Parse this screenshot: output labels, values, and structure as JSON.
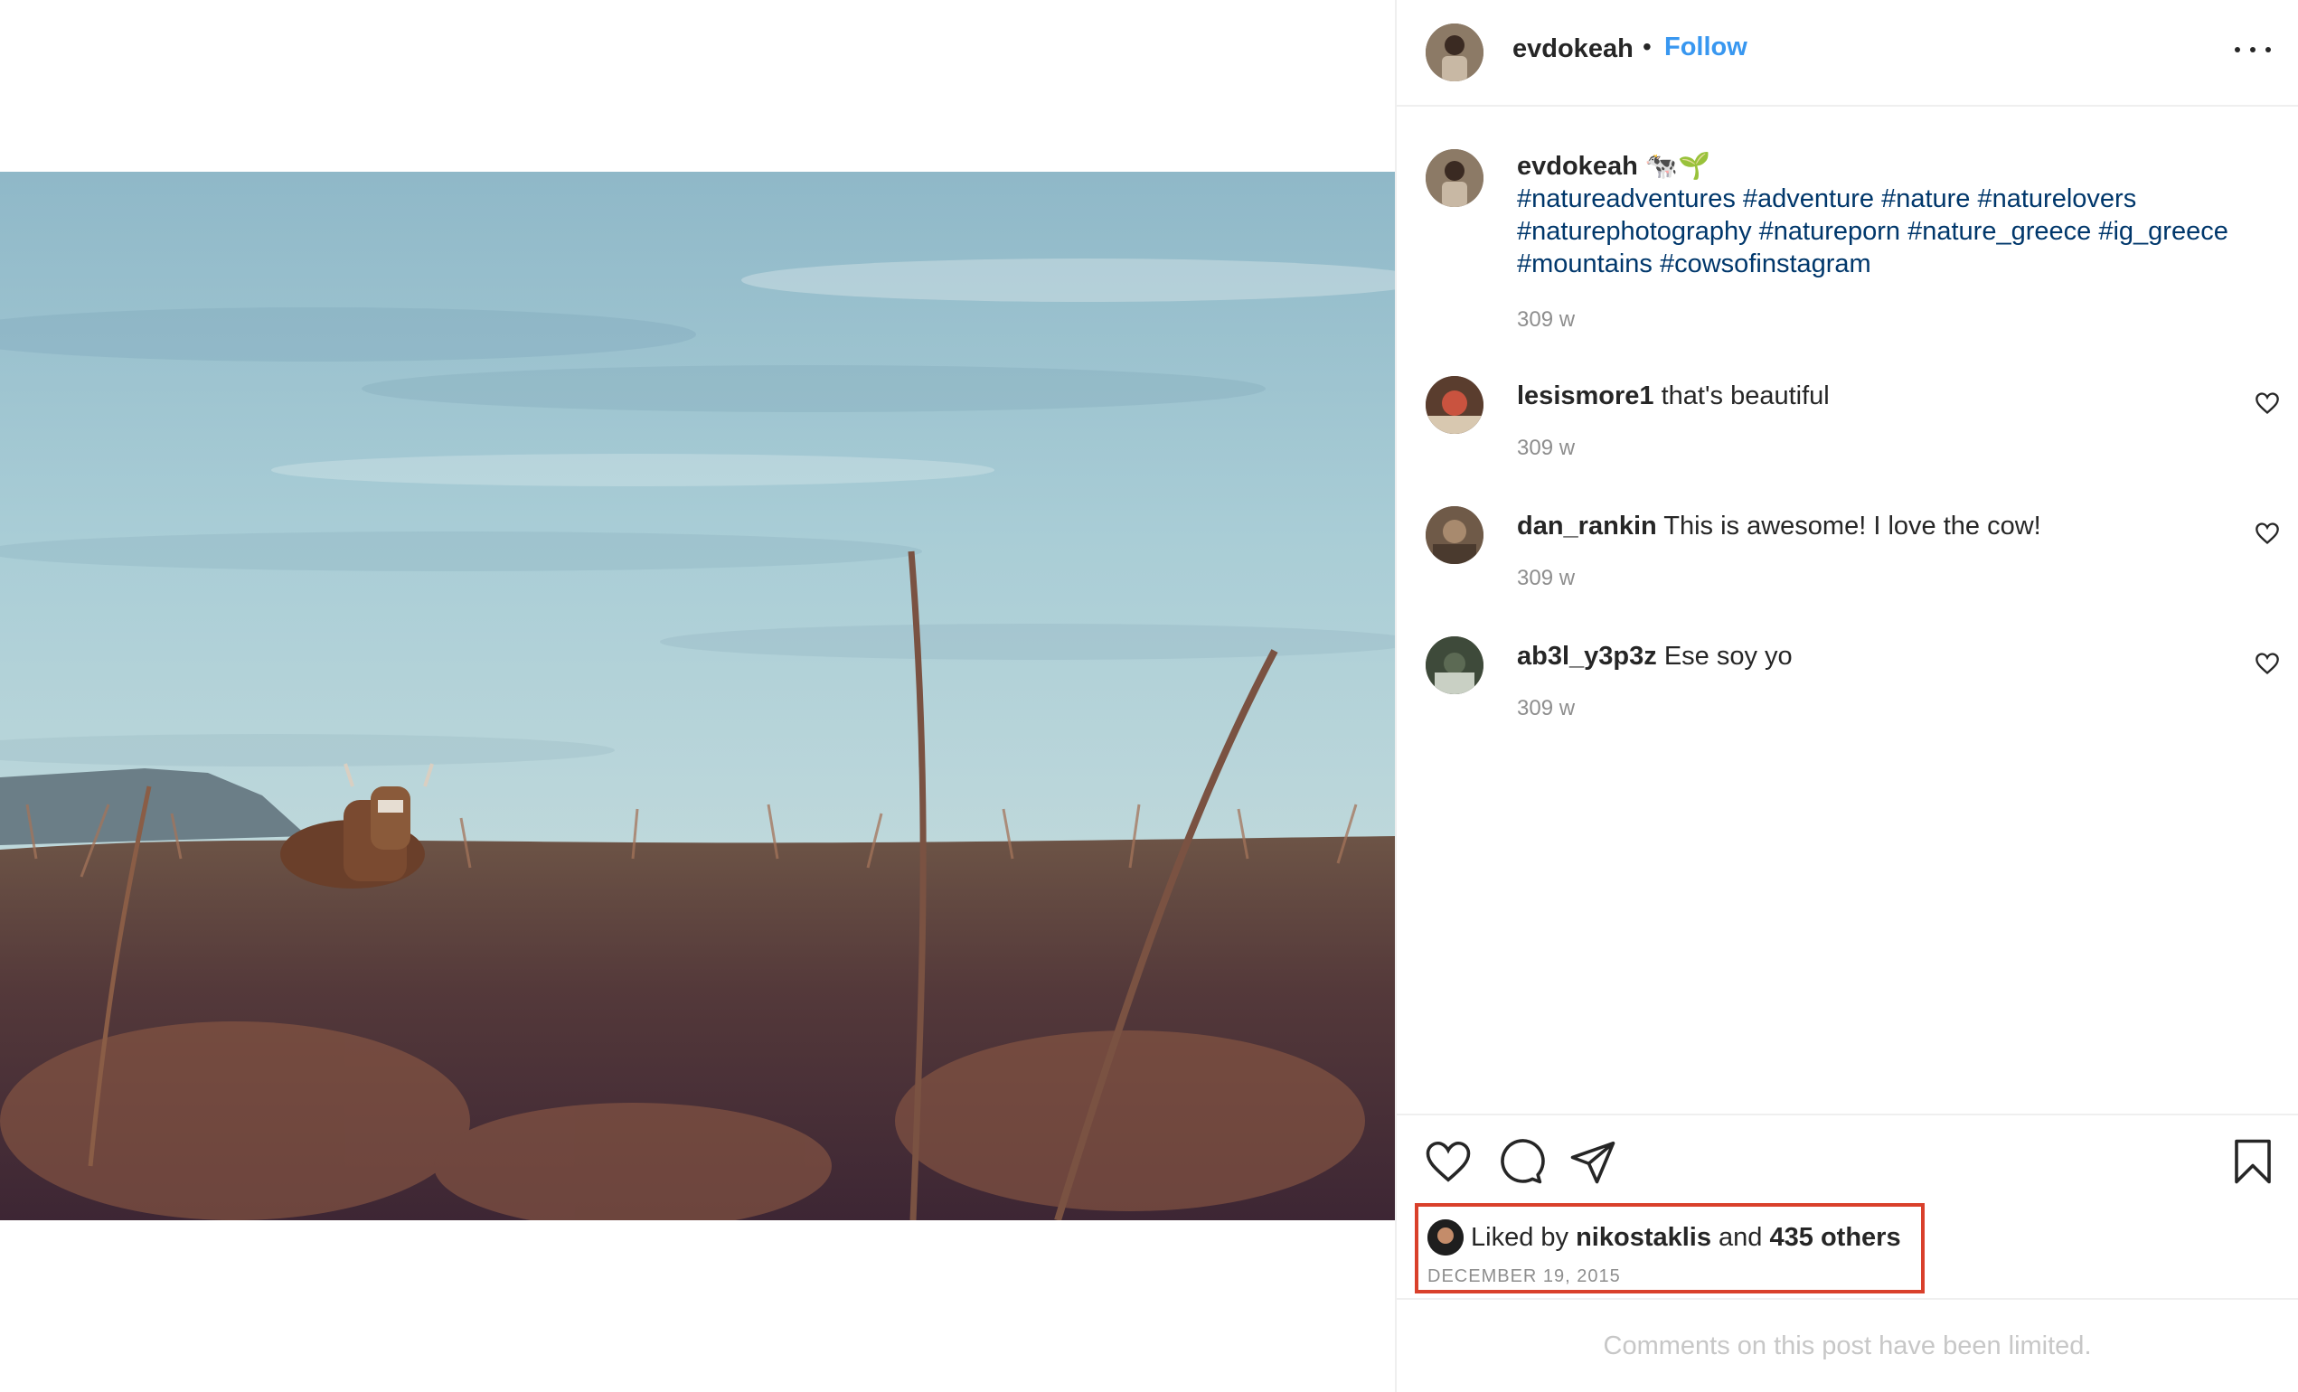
{
  "post": {
    "author": "evdokeah",
    "follow_label": "Follow",
    "separator": "•",
    "more_label": "More options"
  },
  "caption": {
    "username": "evdokeah",
    "emoji": "🐄🌱",
    "hashtags_line1": "#natureadventures #adventure #nature #naturelovers",
    "hashtags_line2": "#naturephotography #natureporn #nature_greece #ig_greece",
    "hashtags_line3": "#mountains #cowsofinstagram",
    "time": "309 w"
  },
  "comments": [
    {
      "username": "lesismore1",
      "text": "that's beautiful",
      "time": "309 w"
    },
    {
      "username": "dan_rankin",
      "text": "This is awesome! I love the cow!",
      "time": "309 w"
    },
    {
      "username": "ab3l_y3p3z",
      "text": "Ese soy yo",
      "time": "309 w"
    }
  ],
  "actions": {
    "like_icon": "heart-icon",
    "comment_icon": "comment-bubble-icon",
    "share_icon": "paper-plane-icon",
    "save_icon": "bookmark-icon"
  },
  "likes": {
    "prefix": "Liked by",
    "liker": "nikostaklis",
    "middle": "and",
    "others": "435 others",
    "date": "DECEMBER 19, 2015"
  },
  "footer": {
    "limited_text": "Comments on this post have been limited."
  },
  "colors": {
    "follow": "#3897f0",
    "hashtag": "#00376b",
    "highlight_box": "#d9402b"
  }
}
